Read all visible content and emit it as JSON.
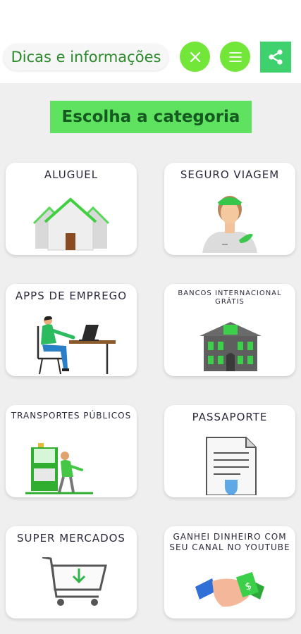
{
  "header": {
    "title": "Dicas e informações",
    "buttons": [
      {
        "name": "close",
        "icon": "close-icon"
      },
      {
        "name": "menu",
        "icon": "hamburger-menu-icon"
      },
      {
        "name": "share",
        "icon": "share-icon"
      }
    ]
  },
  "heading": "Escolha a categoria",
  "categories": [
    {
      "label": "ALUGUEL",
      "icon": "houses-icon"
    },
    {
      "label": "SEGURO VIAGEM",
      "icon": "flight-attendant-icon"
    },
    {
      "label": "APPS DE EMPREGO",
      "icon": "person-at-laptop-icon"
    },
    {
      "label": "BANCOS INTERNACIONAL GRÁTIS",
      "icon": "bank-building-icon"
    },
    {
      "label": "TRANSPORTES PÚBLICOS",
      "icon": "bus-passenger-icon"
    },
    {
      "label": "PASSAPORTE",
      "icon": "passport-document-icon"
    },
    {
      "label": "SUPER MERCADOS",
      "icon": "shopping-cart-icon"
    },
    {
      "label": "GANHEI DINHEIRO COM SEU CANAL NO YOUTUBE",
      "icon": "handshake-money-icon"
    }
  ],
  "colors": {
    "accent": "#73e63a",
    "heading_bg": "#5fe25f",
    "heading_text": "#155a21",
    "share_bg": "#3fd16e",
    "title_text": "#2a8a2a"
  }
}
